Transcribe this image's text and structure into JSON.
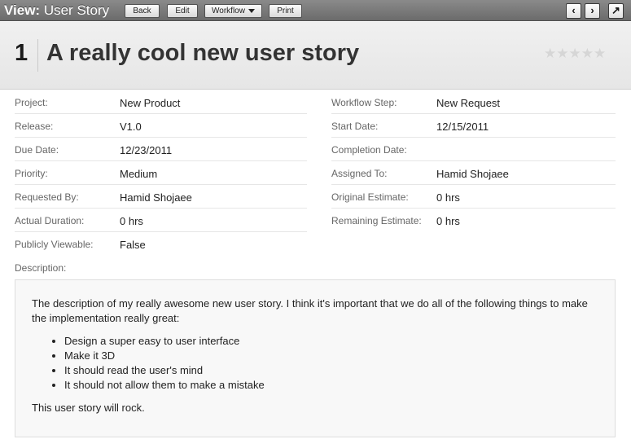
{
  "toolbar": {
    "view_prefix": "View:",
    "view_title": "User Story",
    "buttons": {
      "back": "Back",
      "edit": "Edit",
      "workflow": "Workflow",
      "print": "Print"
    },
    "nav": {
      "prev": "‹",
      "next": "›",
      "popout": "↗"
    }
  },
  "header": {
    "id": "1",
    "title": "A really cool new user story",
    "rating": {
      "value": 0,
      "max": 5,
      "star": "★"
    }
  },
  "fields_left": [
    {
      "label": "Project:",
      "value": "New Product"
    },
    {
      "label": "Release:",
      "value": "V1.0"
    },
    {
      "label": "Due Date:",
      "value": "12/23/2011"
    },
    {
      "label": "Priority:",
      "value": "Medium"
    },
    {
      "label": "Requested By:",
      "value": "Hamid Shojaee"
    },
    {
      "label": "Actual Duration:",
      "value": "0 hrs"
    },
    {
      "label": "Publicly Viewable:",
      "value": "False"
    }
  ],
  "fields_right": [
    {
      "label": "Workflow Step:",
      "value": "New Request"
    },
    {
      "label": "Start Date:",
      "value": "12/15/2011"
    },
    {
      "label": "Completion Date:",
      "value": ""
    },
    {
      "label": "Assigned To:",
      "value": "Hamid Shojaee"
    },
    {
      "label": "Original Estimate:",
      "value": "0 hrs"
    },
    {
      "label": "Remaining Estimate:",
      "value": "0 hrs"
    }
  ],
  "description": {
    "label": "Description:",
    "intro": "The description of my really awesome new user story. I think it's important that we do all of the following things to make the implementation really great:",
    "bullets": [
      "Design a super easy to user interface",
      "Make it 3D",
      "It should read the user's mind",
      "It should not allow them to make a mistake"
    ],
    "closing": "This user story will rock."
  }
}
